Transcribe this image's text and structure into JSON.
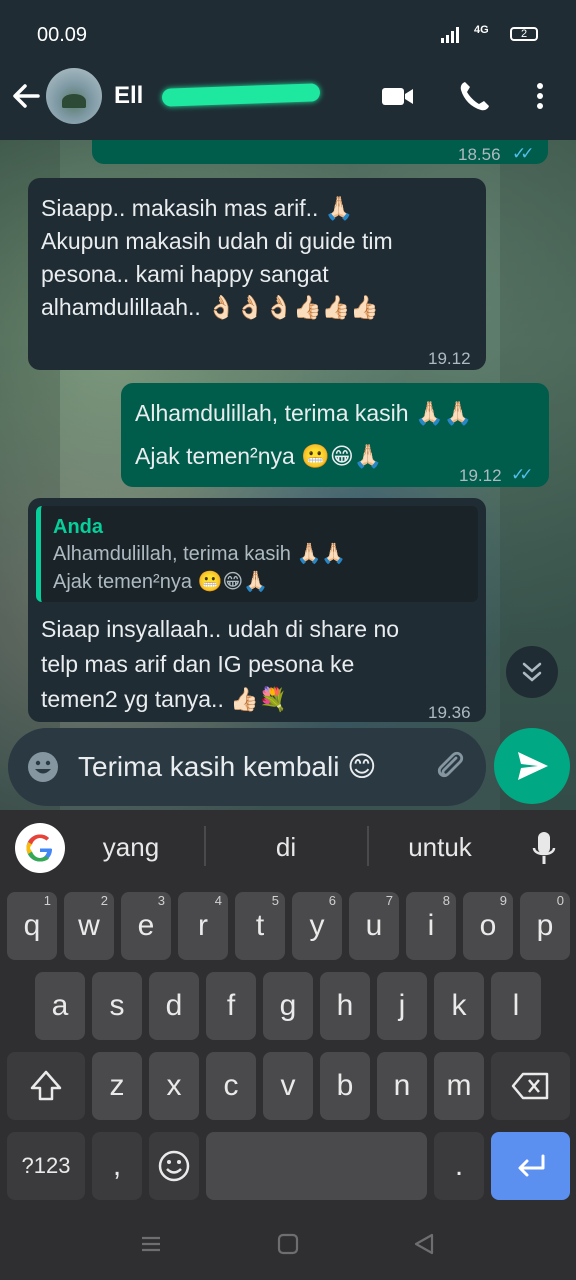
{
  "status": {
    "time": "00.09",
    "network": "4G",
    "battery": "2"
  },
  "header": {
    "contact_name": "Ell"
  },
  "messages": {
    "m0": {
      "time": "18.56"
    },
    "m1": {
      "line1": "Siaapp.. makasih mas arif.. 🙏🏻",
      "line2": "Akupun makasih udah di guide tim",
      "line3": "pesona.. kami happy sangat",
      "line4": "alhamdulillaah.. 👌🏻👌🏻👌🏻👍🏻👍🏻👍🏻",
      "time": "19.12"
    },
    "m2": {
      "line1": "Alhamdulillah, terima kasih 🙏🏻🙏🏻",
      "line2": "Ajak temen²nya 😬😁🙏🏻",
      "time": "19.12"
    },
    "m3": {
      "quote_author": "Anda",
      "quote_line1": "Alhamdulillah, terima kasih 🙏🏻🙏🏻",
      "quote_line2": "Ajak temen²nya 😬😁🙏🏻",
      "line1": "Siaap insyallaah.. udah di share no",
      "line2": "telp mas arif dan IG pesona ke",
      "line3": "temen2 yg tanya.. 👍🏻💐",
      "time": "19.36"
    }
  },
  "input": {
    "value": "Terima kasih kembali 😊"
  },
  "keyboard": {
    "suggestions": [
      "yang",
      "di",
      "untuk"
    ],
    "row1": [
      {
        "k": "q",
        "h": "1"
      },
      {
        "k": "w",
        "h": "2"
      },
      {
        "k": "e",
        "h": "3"
      },
      {
        "k": "r",
        "h": "4"
      },
      {
        "k": "t",
        "h": "5"
      },
      {
        "k": "y",
        "h": "6"
      },
      {
        "k": "u",
        "h": "7"
      },
      {
        "k": "i",
        "h": "8"
      },
      {
        "k": "o",
        "h": "9"
      },
      {
        "k": "p",
        "h": "0"
      }
    ],
    "row2": [
      "a",
      "s",
      "d",
      "f",
      "g",
      "h",
      "j",
      "k",
      "l"
    ],
    "row3": [
      "z",
      "x",
      "c",
      "v",
      "b",
      "n",
      "m"
    ],
    "sym_label": "?123",
    "comma": ",",
    "period": "."
  },
  "colors": {
    "outgoing": "#005c4b",
    "incoming": "#202c33",
    "accent": "#00a884",
    "ticks": "#53bdeb",
    "enter": "#5b8ff0"
  }
}
